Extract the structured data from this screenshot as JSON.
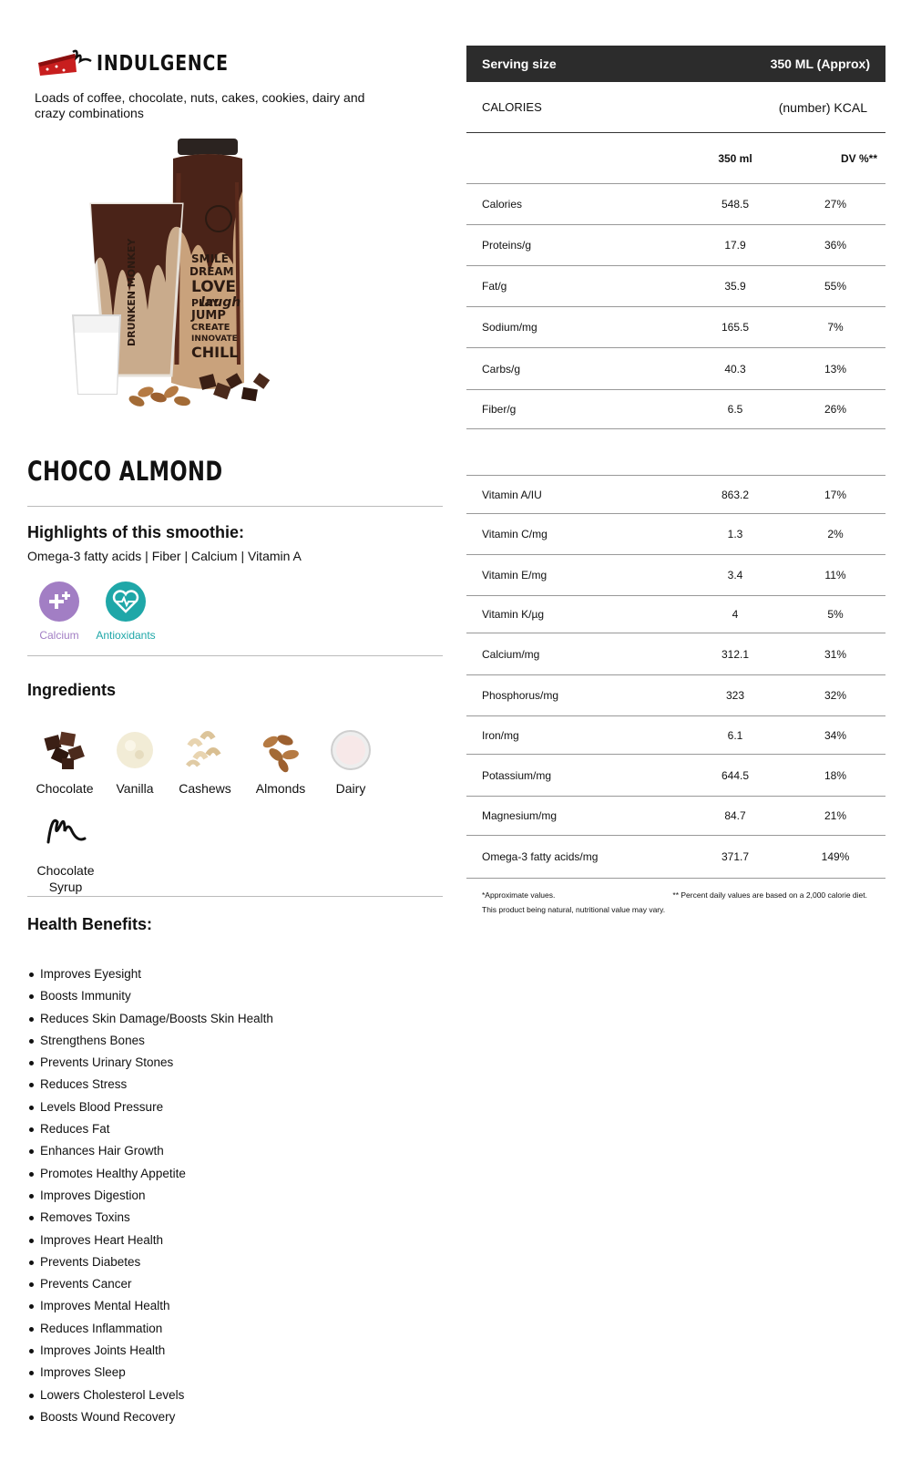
{
  "category": {
    "title": "INDULGENCE",
    "description": "Loads of coffee, chocolate, nuts, cakes, cookies, dairy and crazy combinations"
  },
  "hero": {
    "brand_text": "DRUNKEN MONKEY",
    "bottle_words": [
      "SMILE",
      "DREAM",
      "LOVE",
      "PLAY",
      "laugh",
      "JUMP",
      "CREATE",
      "INNOVATE",
      "CHILL"
    ]
  },
  "product": {
    "name": "CHOCO ALMOND"
  },
  "highlights": {
    "heading": "Highlights of this smoothie:",
    "list_text": "Omega-3 fatty acids | Fiber | Calcium | Vitamin A",
    "badges": [
      {
        "label": "Calcium",
        "color": "#a27ec4",
        "icon": "calcium-icon"
      },
      {
        "label": "Antioxidants",
        "color": "#1fa7a8",
        "icon": "heart-pulse-icon"
      }
    ]
  },
  "ingredients": {
    "heading": "Ingredients",
    "items": [
      {
        "label": "Chocolate",
        "icon": "chocolate-icon"
      },
      {
        "label": "Vanilla",
        "icon": "vanilla-icon"
      },
      {
        "label": "Cashews",
        "icon": "cashews-icon"
      },
      {
        "label": "Almonds",
        "icon": "almonds-icon"
      },
      {
        "label": "Dairy",
        "icon": "dairy-icon"
      }
    ],
    "syrup_line1": "Chocolate",
    "syrup_line2": "Syrup"
  },
  "benefits": {
    "heading": "Health Benefits:",
    "items": [
      "Improves Eyesight",
      "Boosts Immunity",
      "Reduces Skin Damage/Boosts Skin Health",
      "Strengthens Bones",
      "Prevents Urinary Stones",
      "Reduces Stress",
      "Levels Blood Pressure",
      "Reduces Fat",
      "Enhances Hair Growth",
      "Promotes Healthy Appetite",
      "Improves Digestion",
      "Removes Toxins",
      "Improves Heart Health",
      "Prevents Diabetes",
      "Prevents Cancer",
      "Improves Mental Health",
      "Reduces Inflammation",
      "Improves Joints Health",
      "Improves Sleep",
      "Lowers Cholesterol Levels",
      "Boosts Wound Recovery"
    ]
  },
  "nutrition": {
    "serving_label": "Serving size",
    "serving_value": "350 ML (Approx)",
    "calories_label": "CALORIES",
    "calories_value": "(number) KCAL",
    "col_amount": "350 ml",
    "col_dv": "DV %**",
    "rows_a": [
      {
        "name": "Calories",
        "amount": "548.5",
        "dv": "27%"
      },
      {
        "name": "Proteins/g",
        "amount": "17.9",
        "dv": "36%"
      },
      {
        "name": "Fat/g",
        "amount": "35.9",
        "dv": "55%"
      },
      {
        "name": "Sodium/mg",
        "amount": "165.5",
        "dv": "7%"
      },
      {
        "name": "Carbs/g",
        "amount": "40.3",
        "dv": "13%"
      },
      {
        "name": "Fiber/g",
        "amount": "6.5",
        "dv": "26%"
      }
    ],
    "rows_b": [
      {
        "name": "Vitamin A/IU",
        "amount": "863.2",
        "dv": "17%"
      },
      {
        "name": "Vitamin C/mg",
        "amount": "1.3",
        "dv": "2%"
      },
      {
        "name": "Vitamin E/mg",
        "amount": "3.4",
        "dv": "11%"
      },
      {
        "name": "Vitamin K/µg",
        "amount": "4",
        "dv": "5%"
      },
      {
        "name": "Calcium/mg",
        "amount": "312.1",
        "dv": "31%"
      },
      {
        "name": "Phosphorus/mg",
        "amount": "323",
        "dv": "32%"
      },
      {
        "name": "Iron/mg",
        "amount": "6.1",
        "dv": "34%"
      },
      {
        "name": "Potassium/mg",
        "amount": "644.5",
        "dv": "18%"
      },
      {
        "name": "Magnesium/mg",
        "amount": "84.7",
        "dv": "21%"
      },
      {
        "name": "Omega-3 fatty acids/mg",
        "amount": "371.7",
        "dv": "149%"
      }
    ],
    "note_left_1": "*Approximate values.",
    "note_left_2": "This product being natural, nutritional value may vary.",
    "note_right": "** Percent daily values are based on a 2,000 calorie diet."
  }
}
